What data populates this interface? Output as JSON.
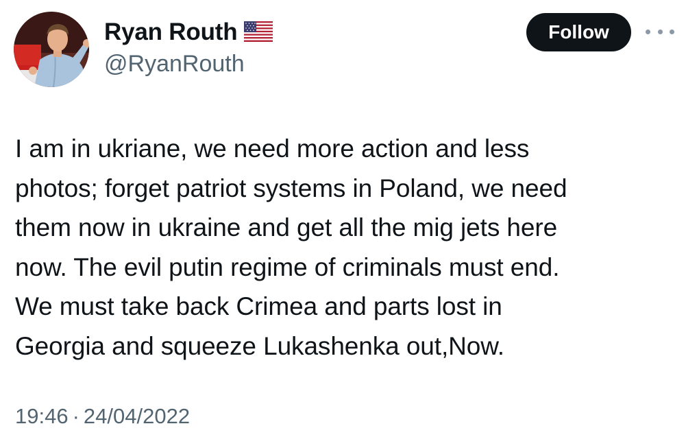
{
  "author": {
    "display_name": "Ryan Routh",
    "flag_icon": "us-flag-icon",
    "handle": "@RyanRouth"
  },
  "actions": {
    "follow_label": "Follow",
    "more_icon": "more-options-icon"
  },
  "tweet": {
    "lines": [
      "I am in ukriane, we need more action and less",
      "photos; forget patriot systems in Poland, we need",
      "them now in ukraine and get all the mig jets here",
      "now. The evil putin regime of criminals must end.",
      "We must take back Crimea and parts lost in",
      "Georgia and squeeze Lukashenka out,Now."
    ]
  },
  "meta": {
    "time": "19:46",
    "separator": "·",
    "date": "24/04/2022"
  },
  "colors": {
    "text_primary": "#0f1419",
    "text_secondary": "#536471",
    "button_bg": "#0f1419",
    "button_text": "#ffffff"
  }
}
